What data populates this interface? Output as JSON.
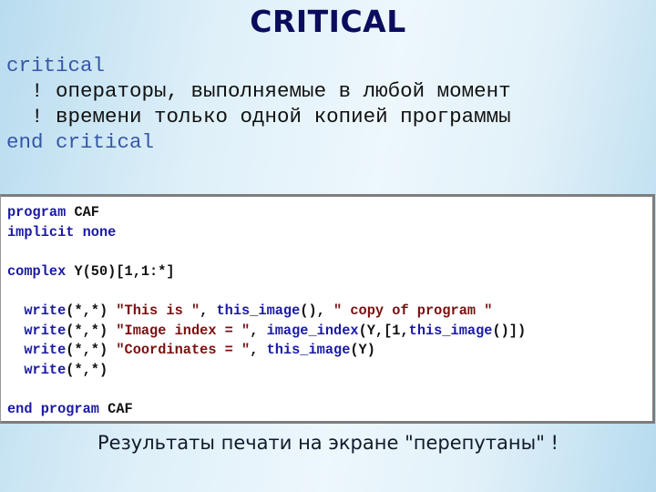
{
  "title": "CRITICAL",
  "intro": {
    "line1_kw": "critical",
    "line2_mark": "  !",
    "line2_text": " операторы, выполняемые в любой момент",
    "line3_mark": "  !",
    "line3_text": " времени только одной копией программы",
    "line4_kw": "end critical"
  },
  "code": {
    "l1_kw": "program",
    "l1_name": " CAF",
    "l2_kw": "implicit none",
    "l4_kw": "complex",
    "l4_rest": " Y(50)[1,1:*]",
    "w1_kw": "  write",
    "w1_args": "(*,*) ",
    "w1_str1": "\"This is \"",
    "w1_sep1": ", ",
    "w1_fn": "this_image",
    "w1_paren": "()",
    "w1_sep2": ", ",
    "w1_str2": "\" copy of program \"",
    "w2_kw": "  write",
    "w2_args": "(*,*) ",
    "w2_str": "\"Image index = \"",
    "w2_sep": ", ",
    "w2_fn": "image_index",
    "w2_p1": "(Y,[1,",
    "w2_fn2": "this_image",
    "w2_p2": "()])",
    "w3_kw": "  write",
    "w3_args": "(*,*) ",
    "w3_str": "\"Coordinates = \"",
    "w3_sep": ", ",
    "w3_fn": "this_image",
    "w3_p": "(Y)",
    "w4_kw": "  write",
    "w4_args": "(*,*)",
    "end_kw": "end program",
    "end_name": " CAF"
  },
  "footer": "Результаты печати на экране \"перепутаны\" !"
}
